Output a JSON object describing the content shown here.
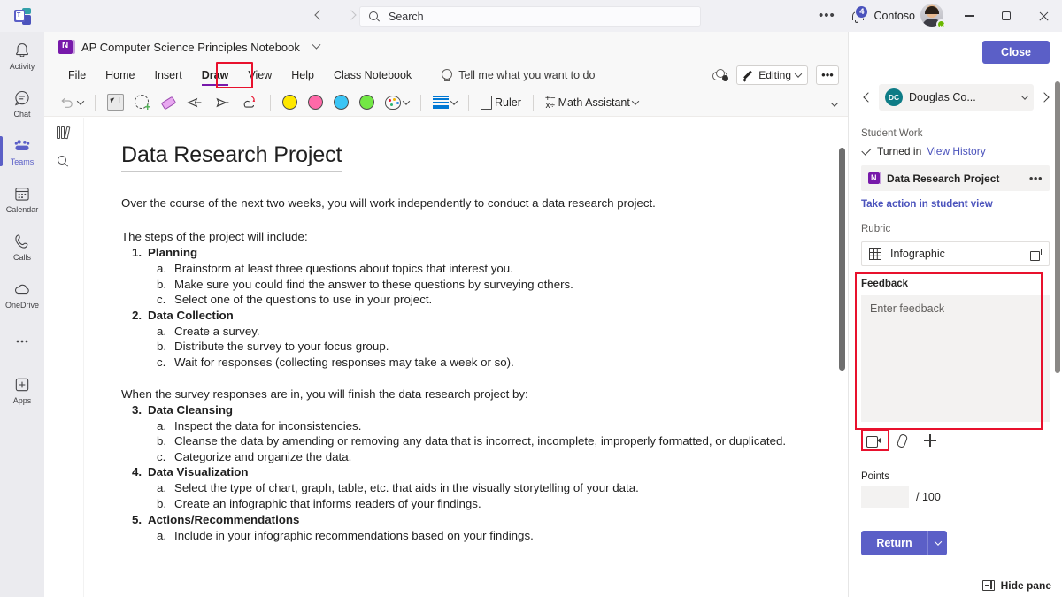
{
  "topbar": {
    "back_icon": "chevron-left-icon",
    "forward_icon": "chevron-right-icon",
    "search_placeholder": "Search",
    "overflow_label": "•••",
    "notification_count": "4",
    "org_name": "Contoso",
    "minimize_label": "",
    "maximize_label": "",
    "close_label": ""
  },
  "rail": {
    "items": [
      {
        "label": "Activity",
        "icon": "bell-icon",
        "active": false
      },
      {
        "label": "Chat",
        "icon": "chat-icon",
        "active": false
      },
      {
        "label": "Teams",
        "icon": "teams-icon",
        "active": true
      },
      {
        "label": "Calendar",
        "icon": "calendar-icon",
        "active": false
      },
      {
        "label": "Calls",
        "icon": "phone-icon",
        "active": false
      },
      {
        "label": "OneDrive",
        "icon": "cloud-icon",
        "active": false
      },
      {
        "label": "",
        "icon": "more-horizontal-icon",
        "active": false
      },
      {
        "label": "Apps",
        "icon": "apps-plus-icon",
        "active": false
      }
    ]
  },
  "onenote": {
    "notebook_title": "AP Computer Science Principles Notebook",
    "tabs": [
      {
        "label": "File",
        "active": false
      },
      {
        "label": "Home",
        "active": false
      },
      {
        "label": "Insert",
        "active": false
      },
      {
        "label": "Draw",
        "active": true
      },
      {
        "label": "View",
        "active": false
      },
      {
        "label": "Help",
        "active": false
      },
      {
        "label": "Class Notebook",
        "active": false
      }
    ],
    "tell_me": "Tell me what you want to do",
    "editing_label": "Editing",
    "ribbon_more": "•••",
    "toolbar": {
      "undo": "undo-icon",
      "select_tool": "lasso-select-text-icon",
      "lasso": "lasso-add-icon",
      "eraser": "eraser-icon",
      "pen1": "pen-icon",
      "pen2": "highlighter-icon",
      "pen3": "ink-to-shape-icon",
      "colors": [
        "#FFE800",
        "#FF69A8",
        "#3BC5F5",
        "#73E845"
      ],
      "palette": "color-palette-icon",
      "thickness": "line-thickness-icon",
      "ruler_label": "Ruler",
      "math_label": "Math Assistant"
    },
    "side_rail": {
      "notebooks_icon": "books-icon",
      "search_icon": "search-icon"
    }
  },
  "document": {
    "title": "Data Research Project",
    "intro": "Over the course of the next two weeks, you will work independently to conduct a data research project.",
    "steps_intro": "The steps of the project will include:",
    "sections_part1": [
      {
        "num": "1.",
        "heading": "Planning",
        "items": [
          {
            "num": "a.",
            "text": "Brainstorm at least three questions about topics that interest you."
          },
          {
            "num": "b.",
            "text": "Make sure you could find the answer to these questions by surveying others."
          },
          {
            "num": "c.",
            "text": "Select one of the questions to use in your project."
          }
        ]
      },
      {
        "num": "2.",
        "heading": "Data Collection",
        "items": [
          {
            "num": "a.",
            "text": "Create a survey."
          },
          {
            "num": "b.",
            "text": "Distribute the survey to your focus group."
          },
          {
            "num": "c.",
            "text": "Wait for responses (collecting responses may take a week or so)."
          }
        ]
      }
    ],
    "mid_para": "When the survey responses are in, you will finish the data research project by:",
    "sections_part2": [
      {
        "num": "3.",
        "heading": "Data Cleansing",
        "items": [
          {
            "num": "a.",
            "text": "Inspect the data for inconsistencies."
          },
          {
            "num": "b.",
            "text": "Cleanse the data by amending or removing any data that is incorrect, incomplete, improperly formatted, or duplicated."
          },
          {
            "num": "c.",
            "text": "Categorize and organize the data."
          }
        ]
      },
      {
        "num": "4.",
        "heading": "Data Visualization",
        "items": [
          {
            "num": "a.",
            "text": "Select the type of chart, graph, table, etc. that aids in the visually storytelling of your data."
          },
          {
            "num": "b.",
            "text": "Create an infographic that informs readers of your findings."
          }
        ]
      },
      {
        "num": "5.",
        "heading": "Actions/Recommendations",
        "items": [
          {
            "num": "a.",
            "text": "Include in your infographic recommendations based on your findings."
          }
        ]
      }
    ]
  },
  "rightpane": {
    "close_label": "Close",
    "student_initials": "DC",
    "student_name": "Douglas Co...",
    "student_work_label": "Student Work",
    "turned_in_label": "Turned in",
    "view_history_label": "View History",
    "work_file": "Data Research Project",
    "work_file_more": "•••",
    "take_action_label": "Take action in student view",
    "rubric_label": "Rubric",
    "rubric_name": "Infographic",
    "feedback_label": "Feedback",
    "feedback_placeholder": "Enter feedback",
    "feedback_value": "",
    "points_label": "Points",
    "points_value": "",
    "points_total": "/ 100",
    "return_label": "Return",
    "hide_pane_label": "Hide pane",
    "annotation_color": "#e8112d"
  }
}
